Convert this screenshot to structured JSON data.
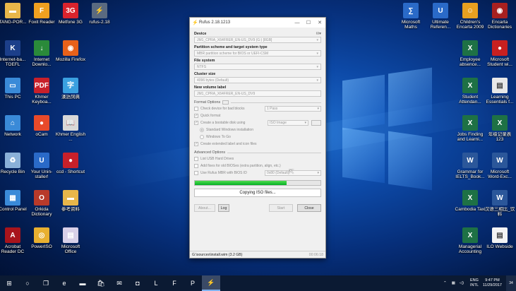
{
  "desktop": {
    "left_icons": [
      {
        "label": "TANG-POR...",
        "icon": "folder-icon",
        "color": "#e8b64a",
        "glyph": "▬"
      },
      {
        "label": "Foxit Reader",
        "icon": "foxit-icon",
        "color": "#f0a020",
        "glyph": "F"
      },
      {
        "label": "Metfone 3G",
        "icon": "metfone-icon",
        "color": "#d9232d",
        "glyph": "3G"
      },
      {
        "label": "rufus-2.18",
        "icon": "usb-icon",
        "color": "#5a6a80",
        "glyph": "⚡"
      },
      {
        "label": "Internet-ba... TOEFL",
        "icon": "kaplan-icon",
        "color": "#1c3f8a",
        "glyph": "K"
      },
      {
        "label": "Internet Downlo...",
        "icon": "idm-icon",
        "color": "#2a8a3a",
        "glyph": "↓"
      },
      {
        "label": "Mozilla Firefox",
        "icon": "firefox-icon",
        "color": "#e8611a",
        "glyph": "◉"
      },
      {
        "label": "This PC",
        "icon": "computer-icon",
        "color": "#3a8ad8",
        "glyph": "▭"
      },
      {
        "label": "Khmer Keyboa...",
        "icon": "pdf-icon",
        "color": "#c8202a",
        "glyph": "PDF"
      },
      {
        "label": "漢語詞典",
        "icon": "dictionary-icon",
        "color": "#3aa0e0",
        "glyph": "字"
      },
      {
        "label": "Network",
        "icon": "network-icon",
        "color": "#3a8ad8",
        "glyph": "⌂"
      },
      {
        "label": "oCam",
        "icon": "ocam-icon",
        "color": "#e84a2a",
        "glyph": "●"
      },
      {
        "label": "Khmer English ...",
        "icon": "book-icon",
        "color": "#d8d8d8",
        "glyph": "📖"
      },
      {
        "label": "Recycle Bin",
        "icon": "recycle-bin-icon",
        "color": "#8ab0d8",
        "glyph": "♻"
      },
      {
        "label": "Your Unin-staller!",
        "icon": "uninstaller-icon",
        "color": "#2a6ac8",
        "glyph": "U"
      },
      {
        "label": "ccd - Shortcut",
        "icon": "ccd-icon",
        "color": "#c8202a",
        "glyph": "●"
      },
      {
        "label": "Control Panel",
        "icon": "control-panel-icon",
        "color": "#3a8ad8",
        "glyph": "▦"
      },
      {
        "label": "Orkida Dictionary",
        "icon": "orkida-icon",
        "color": "#b83a2a",
        "glyph": "O"
      },
      {
        "label": "参考资料",
        "icon": "folder-icon",
        "color": "#e8b64a",
        "glyph": "▬"
      },
      {
        "label": "Acrobat Reader DC",
        "icon": "acrobat-icon",
        "color": "#a8141c",
        "glyph": "A"
      },
      {
        "label": "PowerISO",
        "icon": "poweriso-icon",
        "color": "#e8b030",
        "glyph": "◎"
      },
      {
        "label": "Microsoft Office",
        "icon": "office-icon",
        "color": "#d8d0e8",
        "glyph": "▤"
      }
    ],
    "right_icons": [
      {
        "label": "Microsoft Maths",
        "icon": "maths-icon",
        "color": "#2a6ac8",
        "glyph": "∑"
      },
      {
        "label": "Ultimate Referen...",
        "icon": "reference-icon",
        "color": "#2a6ac8",
        "glyph": "U"
      },
      {
        "label": "Children's Encarta 2009",
        "icon": "encarta-icon",
        "color": "#e8a020",
        "glyph": "☺"
      },
      {
        "label": "Encarta Dictionaries",
        "icon": "encarta-dict-icon",
        "color": "#a82020",
        "glyph": "◉"
      },
      {
        "label": "Employee absence...",
        "icon": "excel-icon",
        "color": "#1e7145",
        "glyph": "X"
      },
      {
        "label": "Microsoft Student wi...",
        "icon": "student-icon",
        "color": "#c82020",
        "glyph": "●"
      },
      {
        "label": "Student Attendan...",
        "icon": "excel-icon",
        "color": "#1e7145",
        "glyph": "X"
      },
      {
        "label": "Learning Essentials f...",
        "icon": "learning-icon",
        "color": "#e8e8e8",
        "glyph": "▤"
      },
      {
        "label": "Jobs Finding and Learni...",
        "icon": "excel-icon",
        "color": "#1e7145",
        "glyph": "X"
      },
      {
        "label": "年级记录表 123",
        "icon": "excel-icon",
        "color": "#1e7145",
        "glyph": "X"
      },
      {
        "label": "Grammar for IELTS_Book...",
        "icon": "word-icon",
        "color": "#2b579a",
        "glyph": "W"
      },
      {
        "label": "Microsoft Word-Exc...",
        "icon": "word-icon",
        "color": "#2b579a",
        "glyph": "W"
      },
      {
        "label": "Cambodia Taxi",
        "icon": "excel-icon",
        "color": "#1e7145",
        "glyph": "X"
      },
      {
        "label": "汉语三相比_饮料",
        "icon": "word-icon",
        "color": "#2b579a",
        "glyph": "W"
      },
      {
        "label": "Managerial Accounting",
        "icon": "excel-icon",
        "color": "#1e7145",
        "glyph": "X"
      },
      {
        "label": "ILO Webside",
        "icon": "document-icon",
        "color": "#f4f4f4",
        "glyph": "▤"
      }
    ]
  },
  "rufus": {
    "title": "Rufus 2.18.1213",
    "device_label": "Device",
    "device_value": "JM1_CPRA_X64FRER_EN-US_DV9 (G:) [8GB]",
    "partition_label": "Partition scheme and target system type",
    "partition_value": "MBR partition scheme for BIOS or UEFI-CSM",
    "fs_label": "File system",
    "fs_value": "NTFS",
    "cluster_label": "Cluster size",
    "cluster_value": "4096 bytes (Default)",
    "volume_label_title": "New volume label",
    "volume_label_value": "JM1_CPRA_X64FRER_EN-US_DV9",
    "format_options": "Format Options",
    "opt_bad_blocks": "Check device for bad blocks",
    "opt_bad_blocks_pass": "1 Pass",
    "opt_quick": "Quick format",
    "opt_bootable": "Create a bootable disk using",
    "opt_bootable_value": "ISO Image",
    "opt_standard": "Standard Windows installation",
    "opt_wintogo": "Windows To Go",
    "opt_ext_label": "Create extended label and icon files",
    "advanced_options": "Advanced Options",
    "opt_usb_hdd": "List USB Hard Drives",
    "opt_old_bios": "Add fixes for old BIOSes (extra partition, align, etc.)",
    "opt_rufus_mbr": "Use Rufus MBR with BIOS ID",
    "opt_rufus_mbr_value": "0x80 (Default)",
    "progress": 0.73,
    "status_text": "Copying ISO files...",
    "about_btn": "About...",
    "log_btn": "Log",
    "start_btn": "Start",
    "close_btn": "Close",
    "statusbar_text": "G:\\sources\\install.wim (3.2 GB)",
    "elapsed": "00:06:18"
  },
  "taskbar": {
    "items": [
      {
        "icon": "start-icon",
        "glyph": "⊞"
      },
      {
        "icon": "cortana-icon",
        "glyph": "○"
      },
      {
        "icon": "task-view-icon",
        "glyph": "❐"
      },
      {
        "icon": "edge-icon",
        "glyph": "e"
      },
      {
        "icon": "file-explorer-icon",
        "glyph": "▬"
      },
      {
        "icon": "store-icon",
        "glyph": "🛍"
      },
      {
        "icon": "mail-icon",
        "glyph": "✉"
      },
      {
        "icon": "camera-icon",
        "glyph": "◘"
      },
      {
        "icon": "line-icon",
        "glyph": "L"
      },
      {
        "icon": "foxit-taskbar-icon",
        "glyph": "F"
      },
      {
        "icon": "powerpoint-icon",
        "glyph": "P"
      },
      {
        "icon": "rufus-taskbar-icon",
        "glyph": "⚡"
      }
    ],
    "lang_top": "ENG",
    "lang_bottom": "INTL",
    "time": "9:47 PM",
    "date": "11/29/2017",
    "notif_count": "34"
  }
}
